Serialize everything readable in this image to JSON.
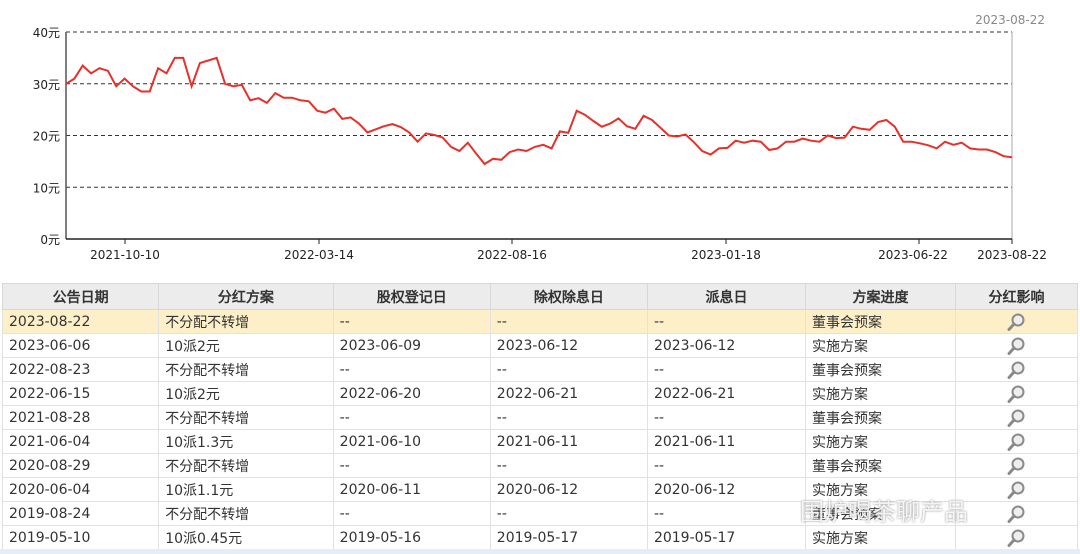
{
  "chart_data": {
    "type": "line",
    "corner_date": "2023-08-22",
    "y_ticks": [
      "0元",
      "10元",
      "20元",
      "30元",
      "40元"
    ],
    "ylim": [
      0,
      40
    ],
    "x_ticks": [
      "2021-10-10",
      "2022-03-14",
      "2022-08-16",
      "2023-01-18",
      "2023-06-22",
      "2023-08-22"
    ],
    "grid": "dashed horizontal",
    "line_color": "#e8302a",
    "values": [
      30,
      31,
      33.5,
      32,
      33,
      32.5,
      29.5,
      31,
      29.5,
      28.5,
      28.5,
      33,
      32,
      35,
      35,
      29.5,
      34,
      34.5,
      35,
      30,
      29.5,
      29.8,
      26.8,
      27.2,
      26.3,
      28.2,
      27.3,
      27.3,
      26.8,
      26.6,
      24.8,
      24.4,
      25.2,
      23.2,
      23.5,
      22.3,
      20.6,
      21.2,
      21.8,
      22.2,
      21.6,
      20.6,
      18.8,
      20.4,
      20.1,
      19.6,
      17.8,
      17.0,
      18.6,
      16.5,
      14.5,
      15.5,
      15.3,
      16.8,
      17.3,
      17.0,
      17.8,
      18.2,
      17.5,
      20.8,
      20.5,
      24.8,
      24.0,
      22.8,
      21.7,
      22.3,
      23.3,
      21.8,
      21.3,
      23.8,
      23.0,
      21.5,
      20.0,
      19.8,
      20.2,
      18.7,
      17.0,
      16.3,
      17.5,
      17.6,
      19.0,
      18.6,
      19.0,
      18.8,
      17.2,
      17.5,
      18.8,
      18.8,
      19.4,
      19.0,
      18.8,
      20.0,
      19.5,
      19.6,
      21.7,
      21.3,
      21.1,
      22.6,
      23.0,
      21.7,
      18.8,
      18.8,
      18.5,
      18.1,
      17.5,
      18.8,
      18.2,
      18.6,
      17.5,
      17.3,
      17.3,
      16.8,
      16.0,
      15.8
    ]
  },
  "table": {
    "headers": [
      "公告日期",
      "分红方案",
      "股权登记日",
      "除权除息日",
      "派息日",
      "方案进度",
      "分红影响"
    ],
    "rows": [
      [
        "2023-08-22",
        "不分配不转增",
        "--",
        "--",
        "--",
        "董事会预案"
      ],
      [
        "2023-06-06",
        "10派2元",
        "2023-06-09",
        "2023-06-12",
        "2023-06-12",
        "实施方案"
      ],
      [
        "2022-08-23",
        "不分配不转增",
        "--",
        "--",
        "--",
        "董事会预案"
      ],
      [
        "2022-06-15",
        "10派2元",
        "2022-06-20",
        "2022-06-21",
        "2022-06-21",
        "实施方案"
      ],
      [
        "2021-08-28",
        "不分配不转增",
        "--",
        "--",
        "--",
        "董事会预案"
      ],
      [
        "2021-06-04",
        "10派1.3元",
        "2021-06-10",
        "2021-06-11",
        "2021-06-11",
        "实施方案"
      ],
      [
        "2020-08-29",
        "不分配不转增",
        "--",
        "--",
        "--",
        "董事会预案"
      ],
      [
        "2020-06-04",
        "10派1.1元",
        "2020-06-11",
        "2020-06-12",
        "2020-06-12",
        "实施方案"
      ],
      [
        "2019-08-24",
        "不分配不转增",
        "--",
        "--",
        "--",
        "董事会预案"
      ],
      [
        "2019-05-10",
        "10派0.45元",
        "2019-05-16",
        "2019-05-17",
        "2019-05-17",
        "实施方案"
      ]
    ],
    "highlight_color": "#fdf0c8",
    "impact_icon": "magnifier-icon"
  },
  "watermark": "围炉喝茶聊产品"
}
